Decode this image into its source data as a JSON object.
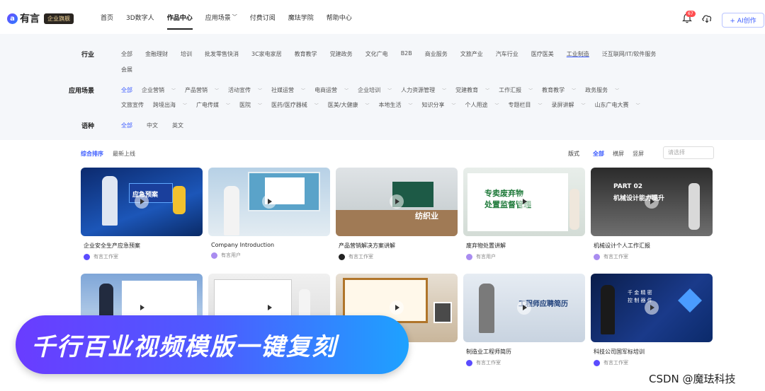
{
  "brand": {
    "name": "有言",
    "badge": "企业旗舰"
  },
  "nav": {
    "items": [
      {
        "label": "首页",
        "active": false,
        "chev": ""
      },
      {
        "label": "3D数字人",
        "active": false,
        "chev": ""
      },
      {
        "label": "作品中心",
        "active": true,
        "chev": ""
      },
      {
        "label": "应用场景",
        "active": false,
        "chev": "﹀"
      },
      {
        "label": "付费订阅",
        "active": false,
        "chev": ""
      },
      {
        "label": "魔珐学院",
        "active": false,
        "chev": ""
      },
      {
        "label": "帮助中心",
        "active": false,
        "chev": ""
      }
    ],
    "notification_count": "67",
    "ai_button": "+ AI创作"
  },
  "filters": {
    "industry": {
      "label": "行业",
      "options": [
        "全部",
        "金融理财",
        "培训",
        "批发零售快消",
        "3C家电家居",
        "教育教学",
        "党建政务",
        "文化广电",
        "B2B",
        "商业服务",
        "文旅产业",
        "汽车行业",
        "医疗医美",
        "工业制造",
        "泛互联网/IT/软件服务"
      ],
      "options2": [
        "会展"
      ]
    },
    "scene": {
      "label": "应用场景",
      "options": [
        "全部",
        "企业营销",
        "产品营销",
        "活动宣传",
        "社媒运营",
        "电商运营",
        "企业培训",
        "人力资源管理",
        "党建教育",
        "工作汇报",
        "教育教学",
        "政务服务"
      ],
      "options2": [
        "文旅宣传",
        "跨境出海",
        "广电传媒",
        "医院",
        "医药/医疗器械",
        "医美/大健康",
        "本地生活",
        "知识分享",
        "个人用途",
        "专题栏目",
        "录屏讲解",
        "山东广电大赛"
      ]
    },
    "language": {
      "label": "语种",
      "options": [
        "全部",
        "中文",
        "英文"
      ]
    }
  },
  "sort": {
    "primary": "综合排序",
    "secondary": "最新上线",
    "format_label": "版式",
    "formats": [
      "全部",
      "横屏",
      "竖屏"
    ],
    "select_placeholder": "请选择"
  },
  "cards_row1": [
    {
      "title": "企业安全生产应急预案",
      "author": "有言工作室"
    },
    {
      "title": "Company Introduction",
      "author": "有言用户"
    },
    {
      "title": "产品营销解决方案讲解",
      "author": "有言工作室"
    },
    {
      "title": "废弃物处置讲解",
      "author": "有言用户"
    },
    {
      "title": "机械设计个人工作汇报",
      "author": "有言工作室"
    }
  ],
  "cards_row2": [
    {
      "title": "",
      "author": ""
    },
    {
      "title": "",
      "author": ""
    },
    {
      "title": "",
      "author": ""
    },
    {
      "title": "制造业工程师简历",
      "author": "有言工作室"
    },
    {
      "title": "科技公司国军标培训",
      "author": "有言工作室"
    }
  ],
  "thumb_text": {
    "t1": "应急预案",
    "t2": "",
    "t3": "纺织业",
    "t4a": "专卖废弃物",
    "t4b": "处置监督管理",
    "t5a": "PART 02",
    "t5b": "机械设计能力提升",
    "t9": "工程师应聘简历",
    "t10": "千 金 精 密\n控 制 器 件"
  },
  "banner": {
    "text": "千行百业视频模版一键复刻"
  },
  "watermark": "CSDN @魔珐科技",
  "colors": {
    "accent": "#3b5bff",
    "banner_start": "#6a3cff",
    "banner_end": "#1ea2ff"
  }
}
